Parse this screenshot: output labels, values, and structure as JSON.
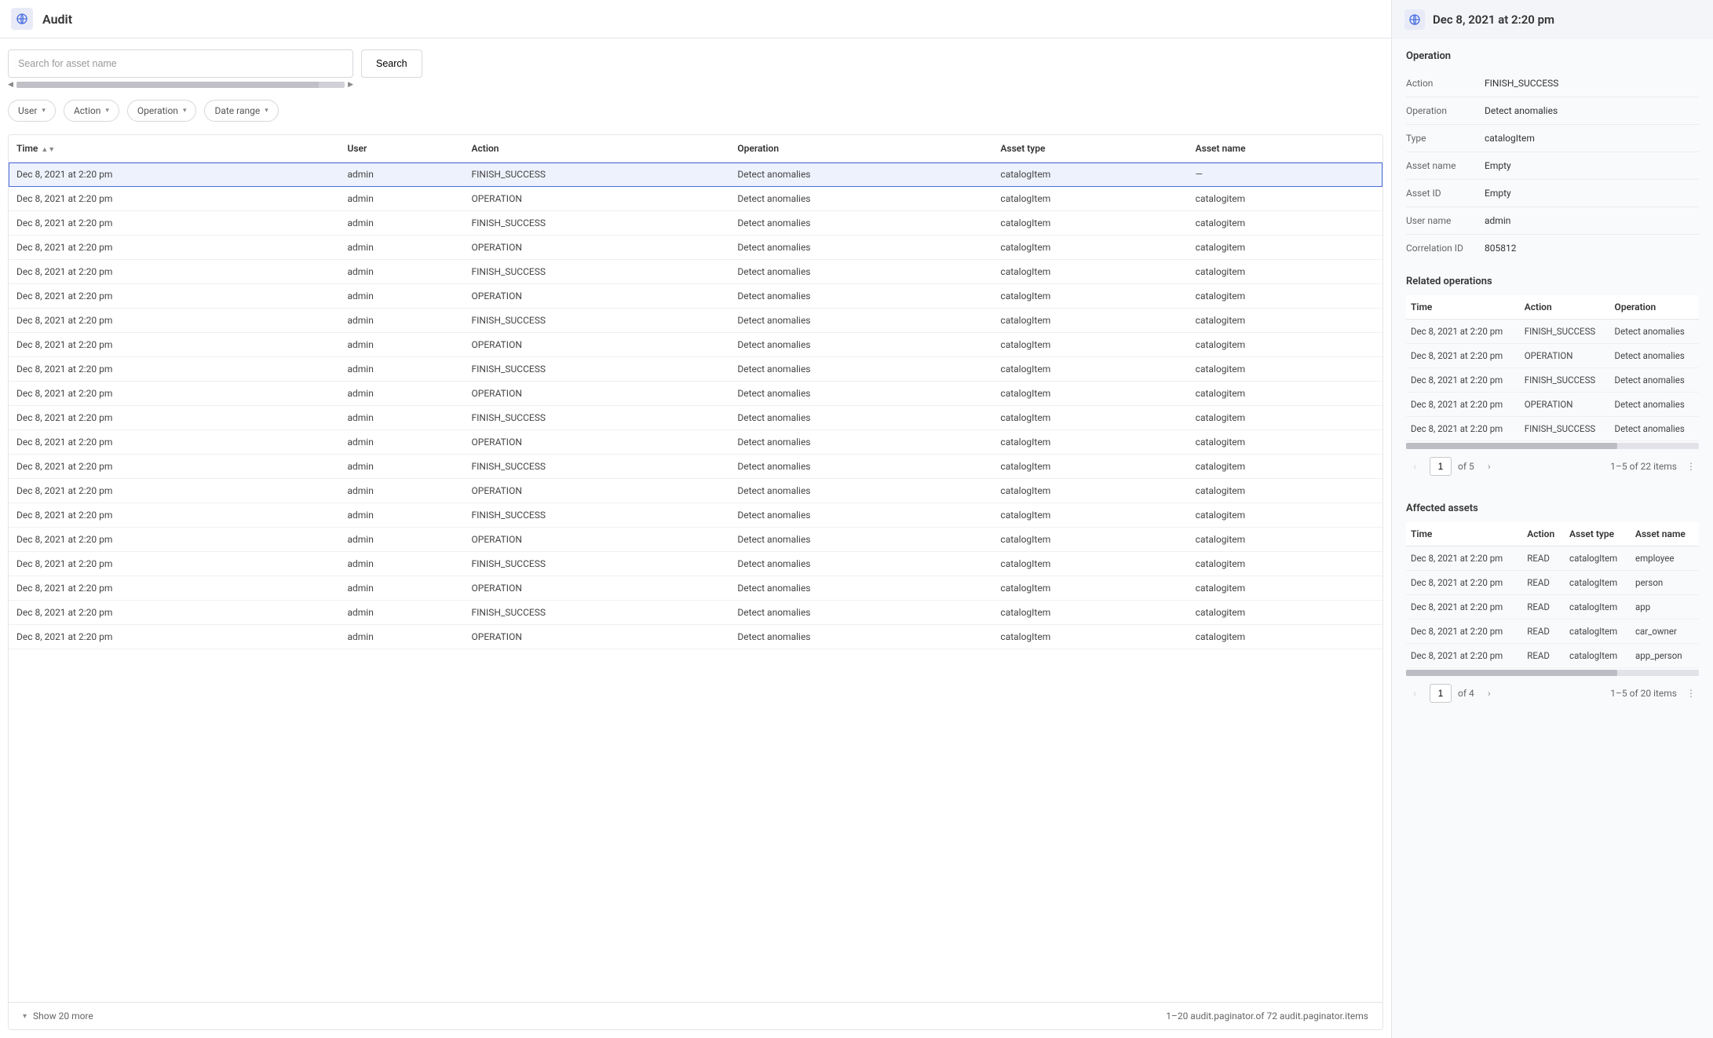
{
  "header": {
    "title": "Audit"
  },
  "search": {
    "placeholder": "Search for asset name",
    "button": "Search"
  },
  "filters": [
    {
      "label": "User"
    },
    {
      "label": "Action"
    },
    {
      "label": "Operation"
    },
    {
      "label": "Date range"
    }
  ],
  "columns": {
    "time": "Time",
    "user": "User",
    "action": "Action",
    "operation": "Operation",
    "asset_type": "Asset type",
    "asset_name": "Asset name"
  },
  "rows": [
    {
      "time": "Dec 8, 2021 at 2:20 pm",
      "user": "admin",
      "action": "FINISH_SUCCESS",
      "operation": "Detect anomalies",
      "asset_type": "catalogItem",
      "asset_name": "—",
      "selected": true
    },
    {
      "time": "Dec 8, 2021 at 2:20 pm",
      "user": "admin",
      "action": "OPERATION",
      "operation": "Detect anomalies",
      "asset_type": "catalogItem",
      "asset_name": "catalogitem"
    },
    {
      "time": "Dec 8, 2021 at 2:20 pm",
      "user": "admin",
      "action": "FINISH_SUCCESS",
      "operation": "Detect anomalies",
      "asset_type": "catalogItem",
      "asset_name": "catalogitem"
    },
    {
      "time": "Dec 8, 2021 at 2:20 pm",
      "user": "admin",
      "action": "OPERATION",
      "operation": "Detect anomalies",
      "asset_type": "catalogItem",
      "asset_name": "catalogitem"
    },
    {
      "time": "Dec 8, 2021 at 2:20 pm",
      "user": "admin",
      "action": "FINISH_SUCCESS",
      "operation": "Detect anomalies",
      "asset_type": "catalogItem",
      "asset_name": "catalogitem"
    },
    {
      "time": "Dec 8, 2021 at 2:20 pm",
      "user": "admin",
      "action": "OPERATION",
      "operation": "Detect anomalies",
      "asset_type": "catalogItem",
      "asset_name": "catalogitem"
    },
    {
      "time": "Dec 8, 2021 at 2:20 pm",
      "user": "admin",
      "action": "FINISH_SUCCESS",
      "operation": "Detect anomalies",
      "asset_type": "catalogItem",
      "asset_name": "catalogitem"
    },
    {
      "time": "Dec 8, 2021 at 2:20 pm",
      "user": "admin",
      "action": "OPERATION",
      "operation": "Detect anomalies",
      "asset_type": "catalogItem",
      "asset_name": "catalogitem"
    },
    {
      "time": "Dec 8, 2021 at 2:20 pm",
      "user": "admin",
      "action": "FINISH_SUCCESS",
      "operation": "Detect anomalies",
      "asset_type": "catalogItem",
      "asset_name": "catalogitem"
    },
    {
      "time": "Dec 8, 2021 at 2:20 pm",
      "user": "admin",
      "action": "OPERATION",
      "operation": "Detect anomalies",
      "asset_type": "catalogItem",
      "asset_name": "catalogitem"
    },
    {
      "time": "Dec 8, 2021 at 2:20 pm",
      "user": "admin",
      "action": "FINISH_SUCCESS",
      "operation": "Detect anomalies",
      "asset_type": "catalogItem",
      "asset_name": "catalogitem"
    },
    {
      "time": "Dec 8, 2021 at 2:20 pm",
      "user": "admin",
      "action": "OPERATION",
      "operation": "Detect anomalies",
      "asset_type": "catalogItem",
      "asset_name": "catalogitem"
    },
    {
      "time": "Dec 8, 2021 at 2:20 pm",
      "user": "admin",
      "action": "FINISH_SUCCESS",
      "operation": "Detect anomalies",
      "asset_type": "catalogItem",
      "asset_name": "catalogitem"
    },
    {
      "time": "Dec 8, 2021 at 2:20 pm",
      "user": "admin",
      "action": "OPERATION",
      "operation": "Detect anomalies",
      "asset_type": "catalogItem",
      "asset_name": "catalogitem"
    },
    {
      "time": "Dec 8, 2021 at 2:20 pm",
      "user": "admin",
      "action": "FINISH_SUCCESS",
      "operation": "Detect anomalies",
      "asset_type": "catalogItem",
      "asset_name": "catalogitem"
    },
    {
      "time": "Dec 8, 2021 at 2:20 pm",
      "user": "admin",
      "action": "OPERATION",
      "operation": "Detect anomalies",
      "asset_type": "catalogItem",
      "asset_name": "catalogitem"
    },
    {
      "time": "Dec 8, 2021 at 2:20 pm",
      "user": "admin",
      "action": "FINISH_SUCCESS",
      "operation": "Detect anomalies",
      "asset_type": "catalogItem",
      "asset_name": "catalogitem"
    },
    {
      "time": "Dec 8, 2021 at 2:20 pm",
      "user": "admin",
      "action": "OPERATION",
      "operation": "Detect anomalies",
      "asset_type": "catalogItem",
      "asset_name": "catalogitem"
    },
    {
      "time": "Dec 8, 2021 at 2:20 pm",
      "user": "admin",
      "action": "FINISH_SUCCESS",
      "operation": "Detect anomalies",
      "asset_type": "catalogItem",
      "asset_name": "catalogitem"
    },
    {
      "time": "Dec 8, 2021 at 2:20 pm",
      "user": "admin",
      "action": "OPERATION",
      "operation": "Detect anomalies",
      "asset_type": "catalogItem",
      "asset_name": "catalogitem"
    }
  ],
  "table_footer": {
    "show_more": "Show 20 more",
    "range": "1–20 audit.paginator.of 72 audit.paginator.items"
  },
  "sidepanel": {
    "title": "Dec 8, 2021 at 2:20 pm",
    "operation_section": {
      "title": "Operation",
      "items": [
        {
          "k": "Action",
          "v": "FINISH_SUCCESS"
        },
        {
          "k": "Operation",
          "v": "Detect anomalies"
        },
        {
          "k": "Type",
          "v": "catalogItem"
        },
        {
          "k": "Asset name",
          "v": "Empty"
        },
        {
          "k": "Asset ID",
          "v": "Empty"
        },
        {
          "k": "User name",
          "v": "admin"
        },
        {
          "k": "Correlation ID",
          "v": "805812"
        }
      ]
    },
    "related_section": {
      "title": "Related operations",
      "columns": {
        "time": "Time",
        "action": "Action",
        "operation": "Operation"
      },
      "rows": [
        {
          "time": "Dec 8, 2021 at 2:20 pm",
          "action": "FINISH_SUCCESS",
          "operation": "Detect anomalies"
        },
        {
          "time": "Dec 8, 2021 at 2:20 pm",
          "action": "OPERATION",
          "operation": "Detect anomalies"
        },
        {
          "time": "Dec 8, 2021 at 2:20 pm",
          "action": "FINISH_SUCCESS",
          "operation": "Detect anomalies"
        },
        {
          "time": "Dec 8, 2021 at 2:20 pm",
          "action": "OPERATION",
          "operation": "Detect anomalies"
        },
        {
          "time": "Dec 8, 2021 at 2:20 pm",
          "action": "FINISH_SUCCESS",
          "operation": "Detect anomalies"
        }
      ],
      "pager": {
        "page": "1",
        "of_label": "of 5",
        "range": "1–5 of 22 items"
      }
    },
    "affected_section": {
      "title": "Affected assets",
      "columns": {
        "time": "Time",
        "action": "Action",
        "asset_type": "Asset type",
        "asset_name": "Asset name"
      },
      "rows": [
        {
          "time": "Dec 8, 2021 at 2:20 pm",
          "action": "READ",
          "asset_type": "catalogItem",
          "asset_name": "employee"
        },
        {
          "time": "Dec 8, 2021 at 2:20 pm",
          "action": "READ",
          "asset_type": "catalogItem",
          "asset_name": "person"
        },
        {
          "time": "Dec 8, 2021 at 2:20 pm",
          "action": "READ",
          "asset_type": "catalogItem",
          "asset_name": "app"
        },
        {
          "time": "Dec 8, 2021 at 2:20 pm",
          "action": "READ",
          "asset_type": "catalogItem",
          "asset_name": "car_owner"
        },
        {
          "time": "Dec 8, 2021 at 2:20 pm",
          "action": "READ",
          "asset_type": "catalogItem",
          "asset_name": "app_person"
        }
      ],
      "pager": {
        "page": "1",
        "of_label": "of 4",
        "range": "1–5 of 20 items"
      }
    }
  }
}
